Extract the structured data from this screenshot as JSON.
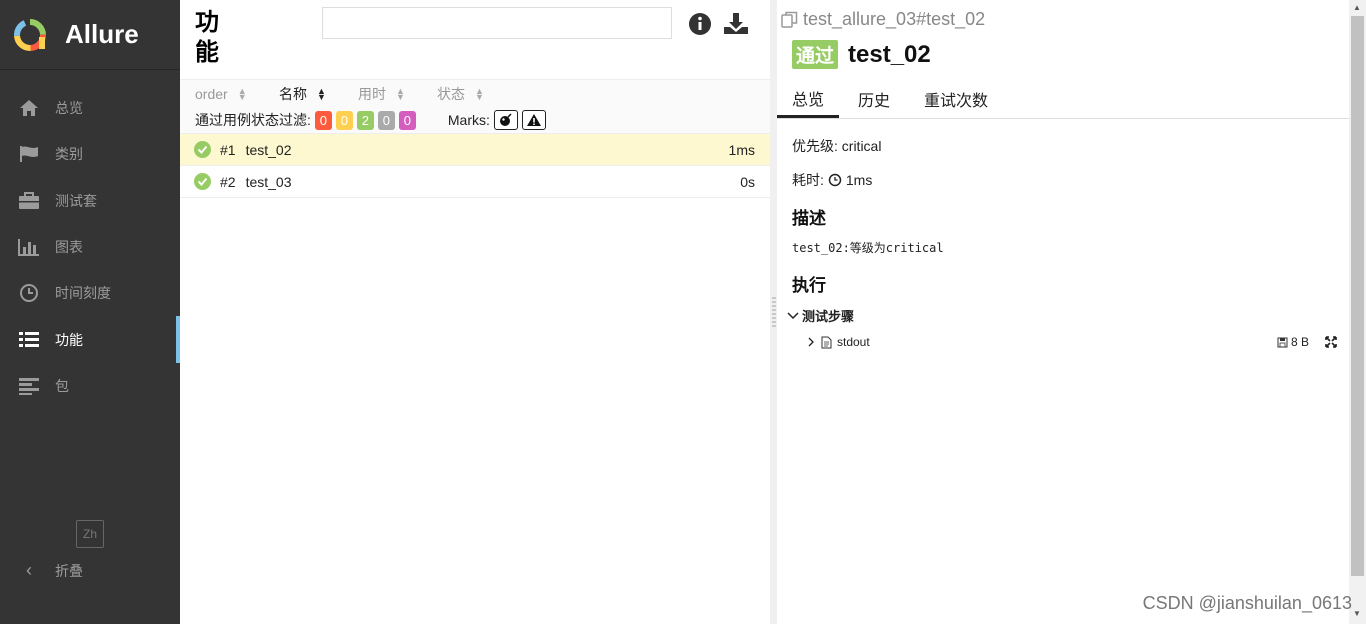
{
  "sidebar": {
    "brand": "Allure",
    "items": [
      {
        "label": "总览",
        "icon": "home-icon"
      },
      {
        "label": "类别",
        "icon": "flag-icon"
      },
      {
        "label": "测试套",
        "icon": "briefcase-icon"
      },
      {
        "label": "图表",
        "icon": "bar-chart-icon"
      },
      {
        "label": "时间刻度",
        "icon": "clock-icon"
      },
      {
        "label": "功能",
        "icon": "list-icon"
      },
      {
        "label": "包",
        "icon": "align-left-icon"
      }
    ],
    "active_index": 5,
    "lang": "Zh",
    "collapse_label": "折叠"
  },
  "middle": {
    "title": "功能",
    "search": {
      "value": "",
      "placeholder": ""
    },
    "sort": {
      "order": "order",
      "name": "名称",
      "duration": "用时",
      "status": "状态"
    },
    "filter": {
      "label": "通过用例状态过滤:",
      "counts": [
        {
          "value": "0",
          "color": "#fd5a3e"
        },
        {
          "value": "0",
          "color": "#ffd050"
        },
        {
          "value": "2",
          "color": "#97cc64"
        },
        {
          "value": "0",
          "color": "#aaaaaa"
        },
        {
          "value": "0",
          "color": "#d35ebe"
        }
      ],
      "marks_label": "Marks:"
    },
    "rows": [
      {
        "num": "#1",
        "name": "test_02",
        "duration": "1ms",
        "selected": true
      },
      {
        "num": "#2",
        "name": "test_03",
        "duration": "0s",
        "selected": false
      }
    ]
  },
  "detail": {
    "breadcrumb": "test_allure_03#test_02",
    "status": "通过",
    "title": "test_02",
    "tabs": [
      "总览",
      "历史",
      "重试次数"
    ],
    "priority": "优先级: critical",
    "duration_label": "耗时:",
    "duration_value": "1ms",
    "description_heading": "描述",
    "description": "test_02:等级为critical",
    "execution_heading": "执行",
    "steps_heading": "测试步骤",
    "attachment_name": "stdout",
    "attachment_size": "8 B"
  },
  "watermark": "CSDN @jianshuilan_0613",
  "colors": {
    "sidebar_bg": "#343434",
    "active_bar": "#7cc1e8",
    "passed": "#97cc64",
    "selected_row": "#fdf8cf"
  }
}
